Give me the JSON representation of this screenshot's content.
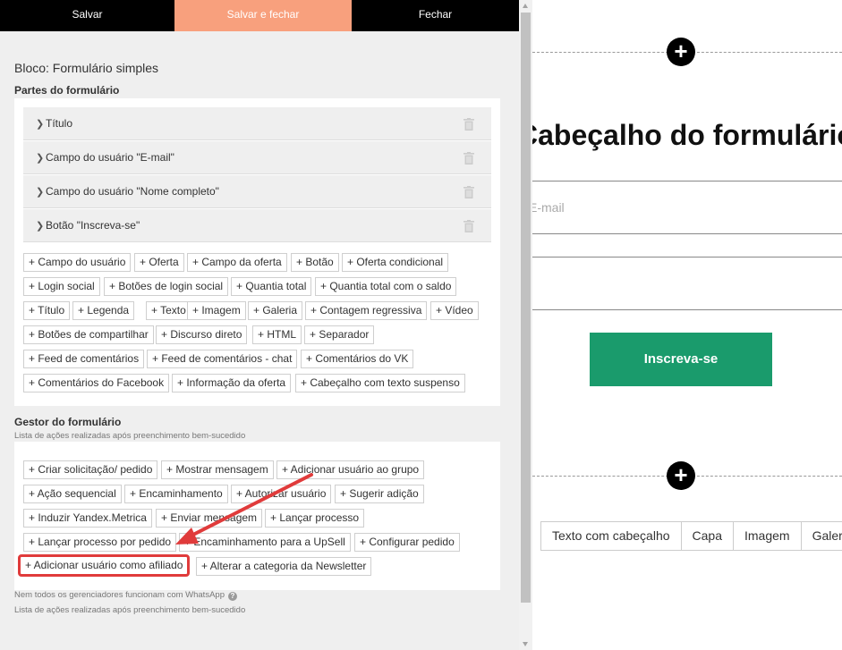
{
  "toolbar": {
    "save": "Salvar",
    "save_close": "Salvar e fechar",
    "close": "Fechar"
  },
  "block_title": "Bloco: Formulário simples",
  "parts": {
    "title": "Partes do formulário",
    "rows": [
      "Título",
      "Campo do usuário \"E-mail\"",
      "Campo do usuário \"Nome completo\"",
      "Botão \"Inscreva-se\""
    ],
    "add_chips": [
      "+ Campo do usuário",
      "+ Oferta",
      "+ Campo da oferta",
      "+ Botão",
      "+ Oferta condicional",
      "+ Login social",
      "+ Botões de login social",
      "+ Quantia total",
      "+ Quantia total com o saldo",
      "+ Título",
      "+ Legenda",
      "+ Texto",
      "+ Imagem",
      "+ Galeria",
      "+ Contagem regressiva",
      "+ Vídeo",
      "+ Botões de compartilhar",
      "+ Discurso direto",
      "+ HTML",
      "+ Separador",
      "+ Feed de comentários",
      "+ Feed de comentários - chat",
      "+ Comentários do VK",
      "+ Comentários do Facebook",
      "+ Informação da oferta",
      "+ Cabeçalho com texto suspenso"
    ]
  },
  "manager": {
    "title": "Gestor do formulário",
    "subtitle": "Lista de ações realizadas após preenchimento bem-sucedido",
    "chips": [
      "+ Criar solicitação/ pedido",
      "+ Mostrar mensagem",
      "+ Adicionar usuário ao grupo",
      "+ Ação sequencial",
      "+ Encaminhamento",
      "+ Autorizar usuário",
      "+ Sugerir adição",
      "+ Induzir Yandex.Metrica",
      "+ Enviar mensagem",
      "+ Lançar processo",
      "+ Lançar processo por pedido",
      "+ Encaminhamento para a UpSell",
      "+ Configurar pedido",
      "+ Adicionar usuário como afiliado",
      "+ Alterar a categoria da Newsletter"
    ],
    "highlighted_chip": "+ Adicionar usuário como afiliado",
    "note1": "Nem todos os gerenciadores funcionam com WhatsApp",
    "note2": "Lista de ações realizadas após preenchimento bem-sucedido"
  },
  "preview": {
    "form_title": "Cabeçalho do formulário",
    "email_placeholder": "E-mail",
    "subscribe_button": "Inscreva-se",
    "block_types": [
      "Texto com cabeçalho",
      "Capa",
      "Imagem",
      "Galeria"
    ]
  },
  "colors": {
    "accent_save_close": "#f8a07d",
    "button_green": "#1a9b6c",
    "annotation_red": "#e03b3b"
  }
}
